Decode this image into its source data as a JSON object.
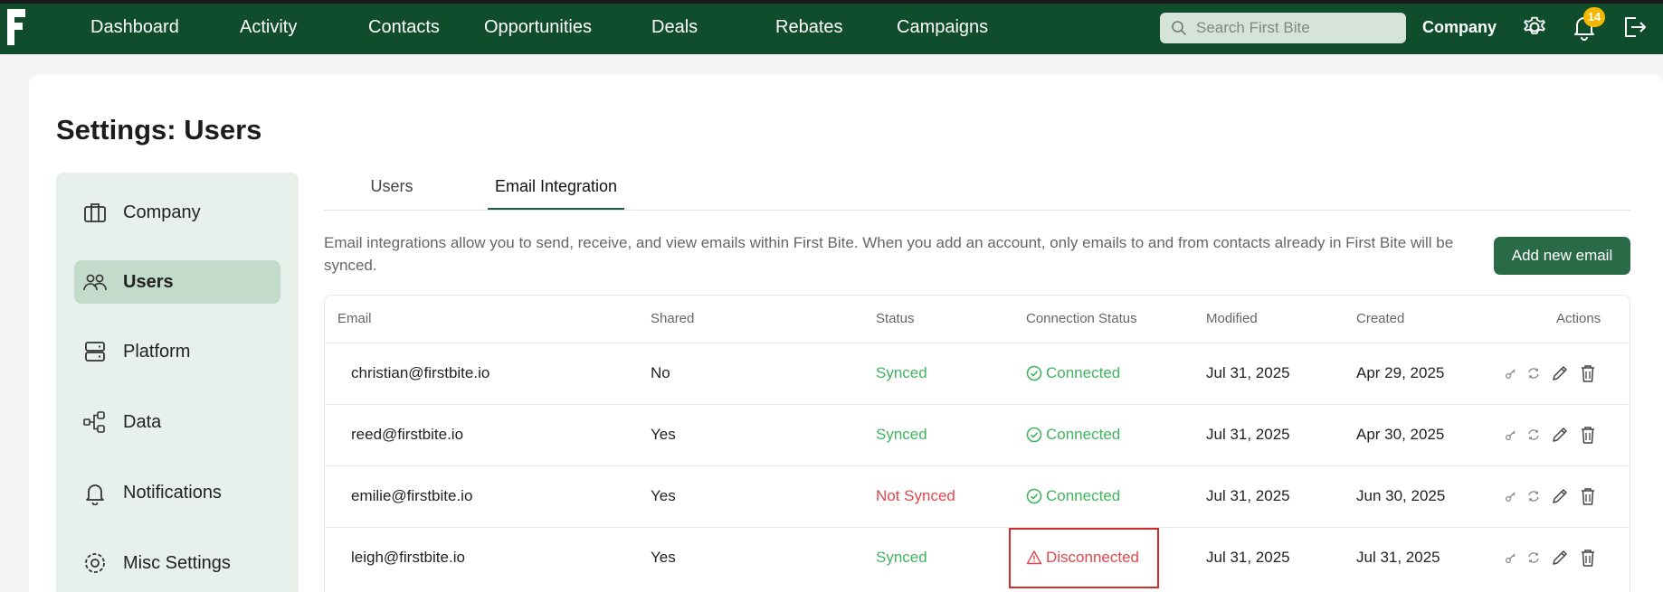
{
  "topbar": {
    "nav": [
      "Dashboard",
      "Activity",
      "Contacts",
      "Opportunities",
      "Deals",
      "Rebates",
      "Campaigns"
    ],
    "search_placeholder": "Search First Bite",
    "company_label": "Company",
    "notification_count": "14"
  },
  "page": {
    "title_prefix": "Settings: ",
    "title_bold": "Users"
  },
  "sidebar": {
    "items": [
      {
        "label": "Company",
        "icon": "briefcase-icon"
      },
      {
        "label": "Users",
        "icon": "users-icon",
        "active": true
      },
      {
        "label": "Platform",
        "icon": "server-icon"
      },
      {
        "label": "Data",
        "icon": "data-flow-icon"
      },
      {
        "label": "Notifications",
        "icon": "bell-icon"
      },
      {
        "label": "Misc Settings",
        "icon": "gear-icon"
      }
    ]
  },
  "tabs": [
    {
      "label": "Users"
    },
    {
      "label": "Email Integration",
      "active": true
    }
  ],
  "description": "Email integrations allow you to send, receive, and view emails within First Bite. When you add an account, only emails to and from contacts already in First Bite will be synced.",
  "add_button": "Add new email",
  "table": {
    "headers": {
      "email": "Email",
      "shared": "Shared",
      "status": "Status",
      "connection": "Connection Status",
      "modified": "Modified",
      "created": "Created",
      "actions": "Actions"
    },
    "rows": [
      {
        "email": "christian@firstbite.io",
        "shared": "No",
        "status": "Synced",
        "connection": "Connected",
        "modified": "Jul 31, 2025",
        "created": "Apr 29, 2025"
      },
      {
        "email": "reed@firstbite.io",
        "shared": "Yes",
        "status": "Synced",
        "connection": "Connected",
        "modified": "Jul 31, 2025",
        "created": "Apr 30, 2025"
      },
      {
        "email": "emilie@firstbite.io",
        "shared": "Yes",
        "status": "Not Synced",
        "connection": "Connected",
        "modified": "Jul 31, 2025",
        "created": "Jun 30, 2025"
      },
      {
        "email": "leigh@firstbite.io",
        "shared": "Yes",
        "status": "Synced",
        "connection": "Disconnected",
        "modified": "Jul 31, 2025",
        "created": "Jul 31, 2025"
      }
    ]
  },
  "colors": {
    "brand": "#0f4d2c",
    "accent": "#2a6b47",
    "success": "#3fb45f",
    "error": "#e0474c",
    "badge": "#f5b800"
  }
}
